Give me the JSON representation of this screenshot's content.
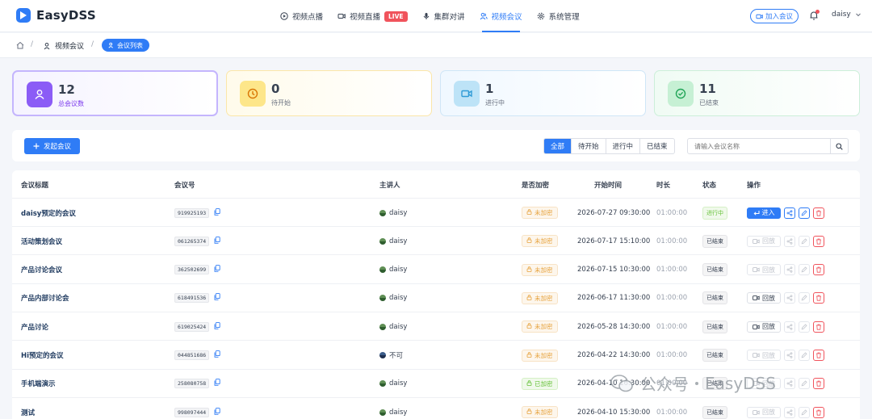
{
  "app": {
    "name": "EasyDSS"
  },
  "nav": [
    {
      "label": "视频点播",
      "icon": "play-circle-icon",
      "active": false
    },
    {
      "label": "视频直播",
      "icon": "video-camera-icon",
      "badge": "LIVE",
      "active": false
    },
    {
      "label": "集群对讲",
      "icon": "microphone-icon",
      "active": false
    },
    {
      "label": "视频会议",
      "icon": "users-icon",
      "active": true
    },
    {
      "label": "系统管理",
      "icon": "gear-icon",
      "active": false
    }
  ],
  "header": {
    "join_label": "加入会议",
    "user": "daisy"
  },
  "breadcrumb": {
    "section": "视频会议",
    "current": "会议列表"
  },
  "stats": [
    {
      "value": "12",
      "label": "总会议数",
      "icon": "users-icon",
      "color": "#8b5cf6"
    },
    {
      "value": "0",
      "label": "待开始",
      "icon": "clock-icon",
      "color": "#f5b82e"
    },
    {
      "value": "1",
      "label": "进行中",
      "icon": "video-camera-icon",
      "color": "#2f9bd6"
    },
    {
      "value": "11",
      "label": "已结束",
      "icon": "check-circle-icon",
      "color": "#34c06b"
    }
  ],
  "toolbar": {
    "create_label": "发起会议",
    "filters": [
      "全部",
      "待开始",
      "进行中",
      "已结束"
    ],
    "active_filter": "全部",
    "search_placeholder": "请输入会议名称"
  },
  "table": {
    "headers": [
      "会议标题",
      "会议号",
      "主讲人",
      "是否加密",
      "开始时间",
      "时长",
      "状态",
      "操作"
    ],
    "rows": [
      {
        "title": "daisy预定的会议",
        "number": "919925193",
        "host": "daisy",
        "encrypted": "未加密",
        "start": "2026-07-27 09:30:00",
        "duration": "01:00:00",
        "status": "进行中",
        "action": "进入"
      },
      {
        "title": "活动策划会议",
        "number": "061265374",
        "host": "daisy",
        "encrypted": "未加密",
        "start": "2026-07-17 15:10:00",
        "duration": "01:00:00",
        "status": "已结束",
        "action": "回放"
      },
      {
        "title": "产品讨论会议",
        "number": "362502699",
        "host": "daisy",
        "encrypted": "未加密",
        "start": "2026-07-15 10:30:00",
        "duration": "01:00:00",
        "status": "已结束",
        "action": "回放"
      },
      {
        "title": "产品内部讨论会",
        "number": "618491536",
        "host": "daisy",
        "encrypted": "未加密",
        "start": "2026-06-17 11:30:00",
        "duration": "01:00:00",
        "status": "已结束",
        "action": "回放"
      },
      {
        "title": "产品讨论",
        "number": "619025424",
        "host": "daisy",
        "encrypted": "未加密",
        "start": "2026-05-28 14:30:00",
        "duration": "01:00:00",
        "status": "已结束",
        "action": "回放"
      },
      {
        "title": "Hi预定的会议",
        "number": "044851686",
        "host": "不可",
        "encrypted": "未加密",
        "start": "2026-04-22 14:30:00",
        "duration": "01:00:00",
        "status": "已结束",
        "action": "回放"
      },
      {
        "title": "手机端演示",
        "number": "258080758",
        "host": "daisy",
        "encrypted": "已加密",
        "start": "2026-04-10 16:30:00",
        "duration": "01:00:00",
        "status": "已结束",
        "action": "回放"
      },
      {
        "title": "测试",
        "number": "998097444",
        "host": "daisy",
        "encrypted": "未加密",
        "start": "2026-04-10 15:30:00",
        "duration": "01:00:00",
        "status": "已结束",
        "action": "回放"
      }
    ]
  },
  "watermark": {
    "text1": "公众号",
    "text2": "EasyDSS"
  }
}
